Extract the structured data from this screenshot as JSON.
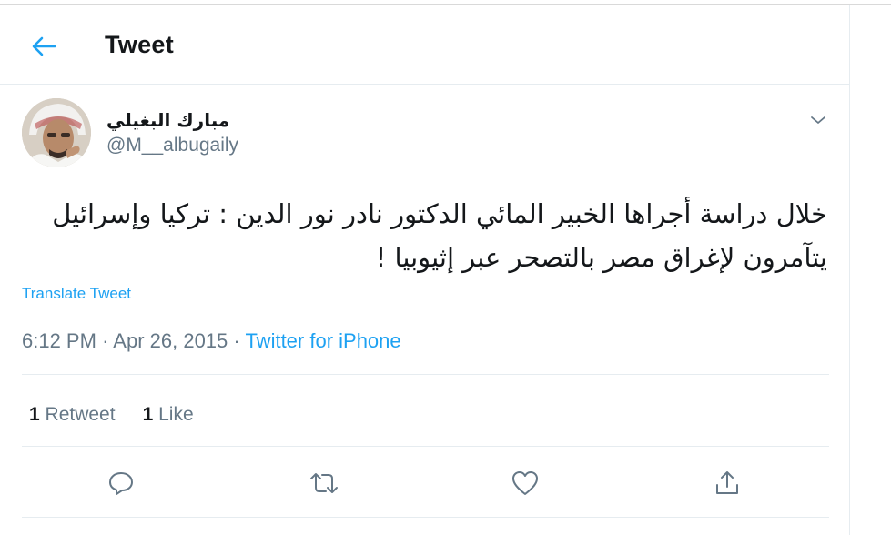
{
  "header": {
    "title": "Tweet"
  },
  "tweet": {
    "author_name": "مبارك البغيلي",
    "author_handle": "@M__albugaily",
    "text": "خلال دراسة أجراها الخبير المائي الدكتور نادر نور الدين : تركيا وإسرائيل يتآمرون لإغراق مصر بالتصحر عبر إثيوبيا !",
    "translate_label": "Translate Tweet",
    "time": "6:12 PM",
    "date": "Apr 26, 2015",
    "separator": "·",
    "source": "Twitter for iPhone",
    "retweets": {
      "count": "1",
      "label": "Retweet"
    },
    "likes": {
      "count": "1",
      "label": "Like"
    }
  },
  "icons": {
    "back": "arrow-left-icon",
    "caret": "chevron-down-icon",
    "reply": "reply-icon",
    "retweet": "retweet-icon",
    "like": "heart-icon",
    "share": "share-icon"
  },
  "colors": {
    "accent": "#1da1f2",
    "muted": "#657786",
    "text": "#14171a",
    "border": "#e6ecf0"
  }
}
